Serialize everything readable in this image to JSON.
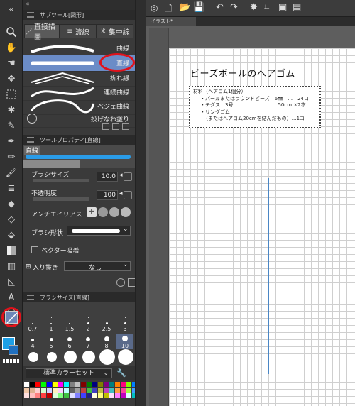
{
  "canvas_tab": "イラスト*",
  "subtool_panel": {
    "title": "サブツール[図形]",
    "tabs": [
      {
        "label": "直接描画"
      },
      {
        "label": "流線"
      },
      {
        "label": "集中線"
      }
    ],
    "brushes": [
      {
        "label": "曲線"
      },
      {
        "label": "直線"
      },
      {
        "label": "折れ線"
      },
      {
        "label": "連続曲線"
      },
      {
        "label": "ベジェ曲線"
      },
      {
        "label": "投げなわ塗り"
      }
    ]
  },
  "tool_property": {
    "title": "ツールプロパティ[直線]",
    "preview_label": "直線",
    "brush_size_label": "ブラシサイズ",
    "brush_size_value": "10.0",
    "opacity_label": "不透明度",
    "opacity_value": "100",
    "antialias_label": "アンチエイリアス",
    "brush_shape_label": "ブラシ形状",
    "vector_snap_label": "ベクター吸着",
    "taper_label": "入り抜き",
    "taper_value": "なし"
  },
  "brush_size_panel": {
    "title": "ブラシサイズ[直線]",
    "sizes": [
      "0.7",
      "1",
      "1.5",
      "2",
      "2.5",
      "3",
      "4",
      "5",
      "6",
      "7",
      "8",
      "10"
    ]
  },
  "color_set": {
    "name": "標準カラーセット"
  },
  "document": {
    "title": "ビーズボールのヘアゴム",
    "materials": [
      "材料（ヘアゴム1個分）",
      "・パールまたはラウンドビーズ　6㎜　…　24コ",
      "・テグス　3号　　　　　　　　…50cm ×2本",
      "・リングゴム",
      "（またはヘアゴム20cmを結んだもの）…1コ"
    ]
  },
  "colors": {
    "highlight_circle": "#e0121b",
    "selection": "#6b8cc7",
    "accent_blue": "#1ea0e6",
    "drawn_line": "#4a86c5"
  }
}
